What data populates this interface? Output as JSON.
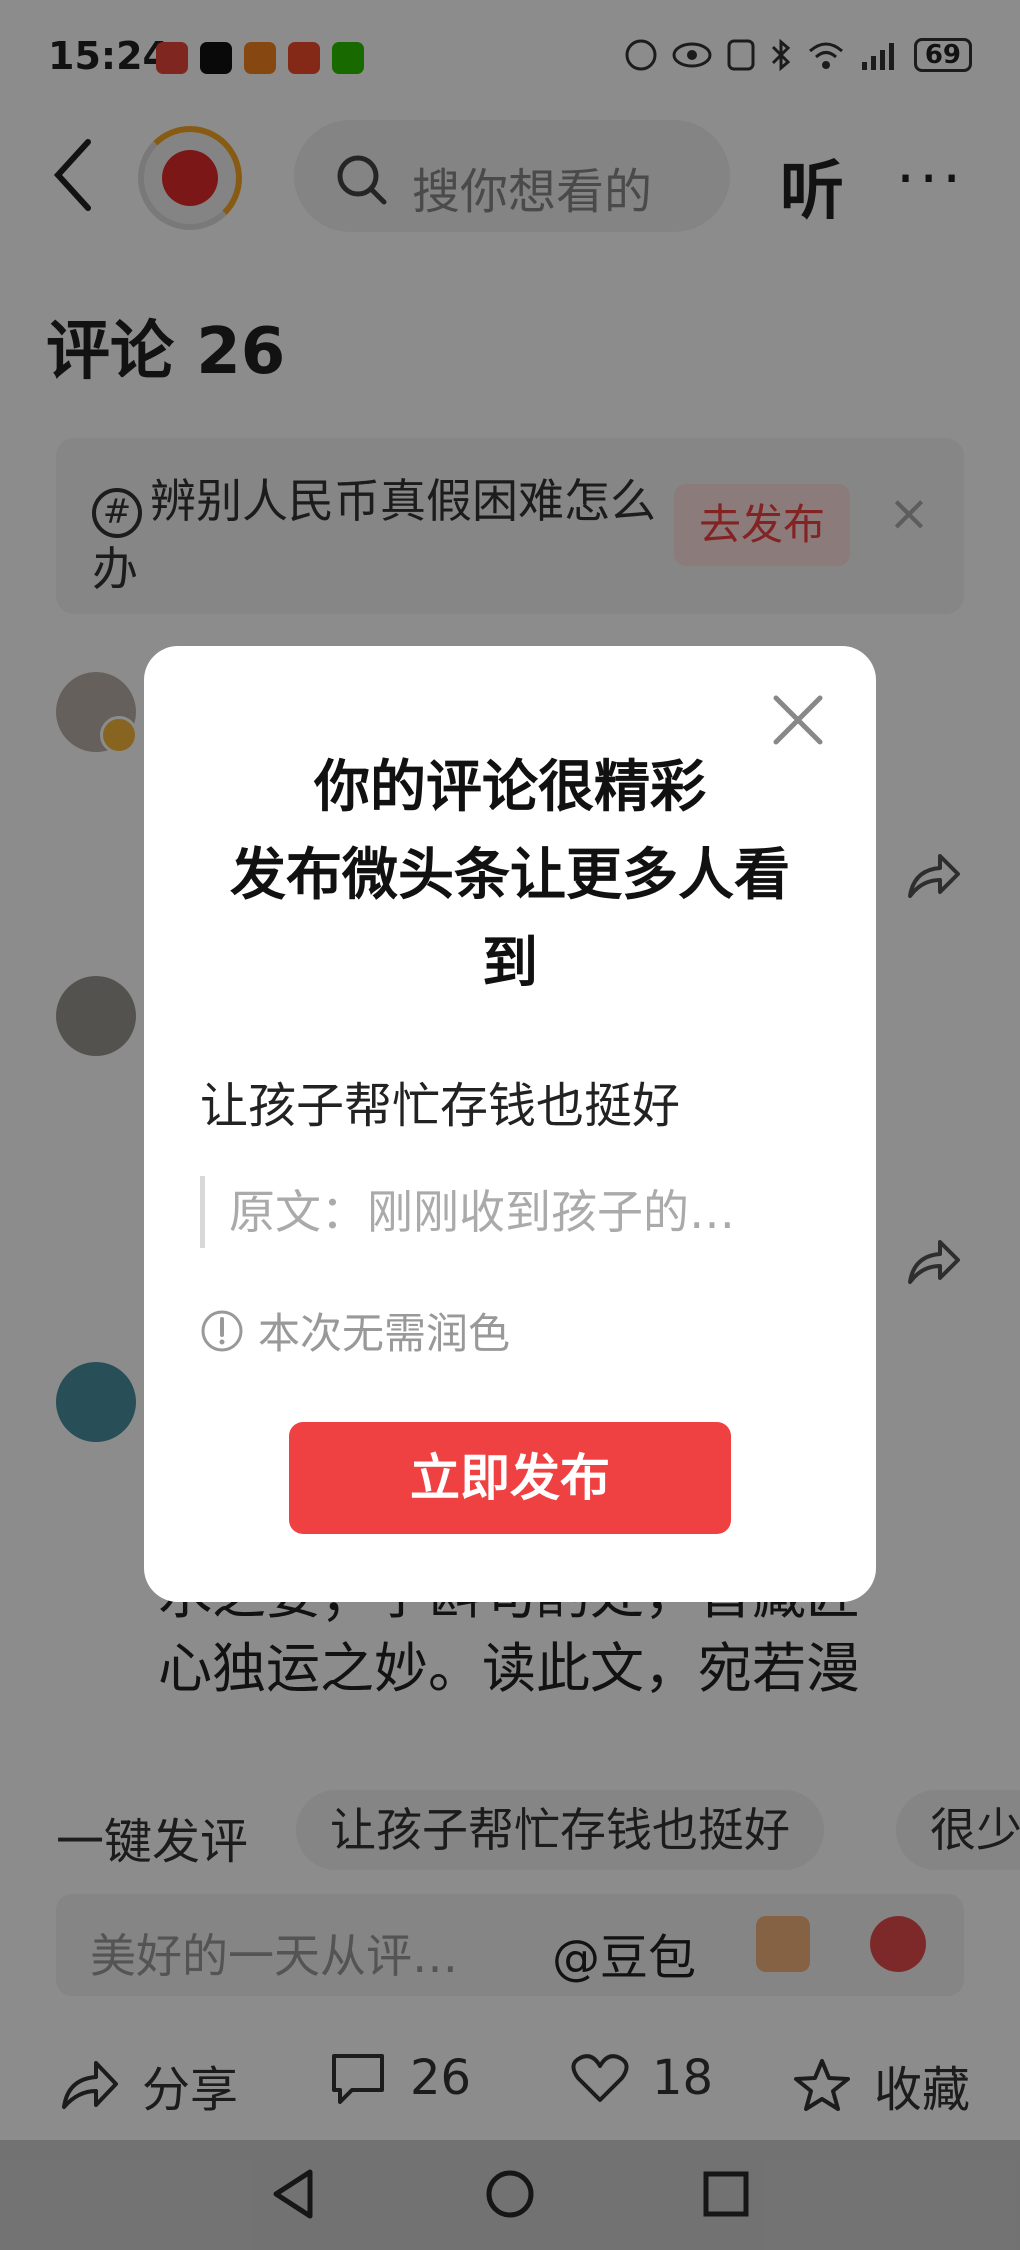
{
  "status_bar": {
    "time": "15:24",
    "battery": "69"
  },
  "header": {
    "search_placeholder": "搜你想看的",
    "listen_label": "听",
    "more_label": "···"
  },
  "comments": {
    "title": "评论 26"
  },
  "topic": {
    "text": "辨别人民币真假困难怎么办",
    "publish_label": "去发布",
    "close_label": "×"
  },
  "comment_body": "……\n埃。起承转合间，尽显行云流\n水之姿；字斟句酌处，皆藏匠\n心独运之妙。读此文，宛若漫",
  "quick_reply": {
    "label": "一键发评",
    "chips": [
      "让孩子帮忙存钱也挺好",
      "很少"
    ]
  },
  "input": {
    "placeholder": "美好的一天从评…",
    "doubao": "@豆包"
  },
  "bottom_bar": {
    "share_label": "分享",
    "comment_count": "26",
    "like_count": "18",
    "fav_label": "收藏"
  },
  "modal": {
    "title_line1": "你的评论很精彩",
    "title_line2": "发布微头条让更多人看",
    "title_line3": "到",
    "quote": "让孩子帮忙存钱也挺好",
    "original": "原文：刚刚收到孩子的…",
    "hint": "本次无需润色",
    "publish_button": "立即发布"
  },
  "colors": {
    "accent": "#f04142",
    "overlay": "rgba(0,0,0,0.45)"
  }
}
